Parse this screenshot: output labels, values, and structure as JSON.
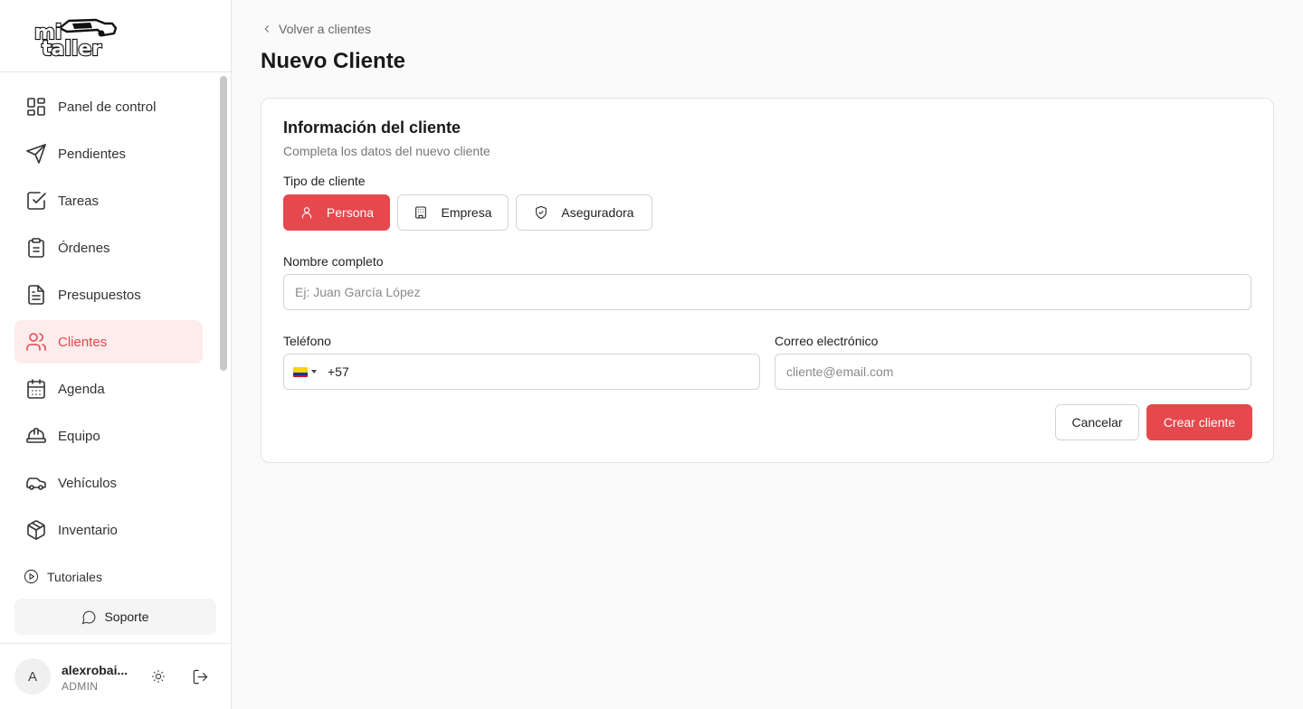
{
  "app": {
    "logo_text_top": "mi",
    "logo_text_bottom": "taller"
  },
  "sidebar": {
    "items": [
      {
        "label": "Panel de control",
        "icon": "dashboard-icon"
      },
      {
        "label": "Pendientes",
        "icon": "send-icon"
      },
      {
        "label": "Tareas",
        "icon": "checkbox-icon"
      },
      {
        "label": "Órdenes",
        "icon": "clipboard-icon"
      },
      {
        "label": "Presupuestos",
        "icon": "document-icon"
      },
      {
        "label": "Clientes",
        "icon": "users-icon",
        "active": true
      },
      {
        "label": "Agenda",
        "icon": "calendar-icon"
      },
      {
        "label": "Equipo",
        "icon": "hardhat-icon"
      },
      {
        "label": "Vehículos",
        "icon": "car-icon"
      },
      {
        "label": "Inventario",
        "icon": "box-icon"
      }
    ],
    "tutorials_label": "Tutoriales",
    "support_label": "Soporte"
  },
  "user": {
    "initial": "A",
    "name": "alexrobai...",
    "role": "ADMIN"
  },
  "header": {
    "back_label": "Volver a clientes",
    "title": "Nuevo Cliente"
  },
  "form": {
    "card_title": "Información del cliente",
    "card_subtitle": "Completa los datos del nuevo cliente",
    "type_label": "Tipo de cliente",
    "types": [
      {
        "label": "Persona",
        "icon": "user-icon",
        "selected": true
      },
      {
        "label": "Empresa",
        "icon": "building-icon"
      },
      {
        "label": "Aseguradora",
        "icon": "shield-icon"
      }
    ],
    "name_label": "Nombre completo",
    "name_placeholder": "Ej: Juan García López",
    "phone_label": "Teléfono",
    "phone_dial_code": "+57",
    "email_label": "Correo electrónico",
    "email_placeholder": "cliente@email.com",
    "cancel_label": "Cancelar",
    "submit_label": "Crear cliente"
  },
  "colors": {
    "accent": "#e5484d",
    "active_bg": "#fdecec"
  }
}
